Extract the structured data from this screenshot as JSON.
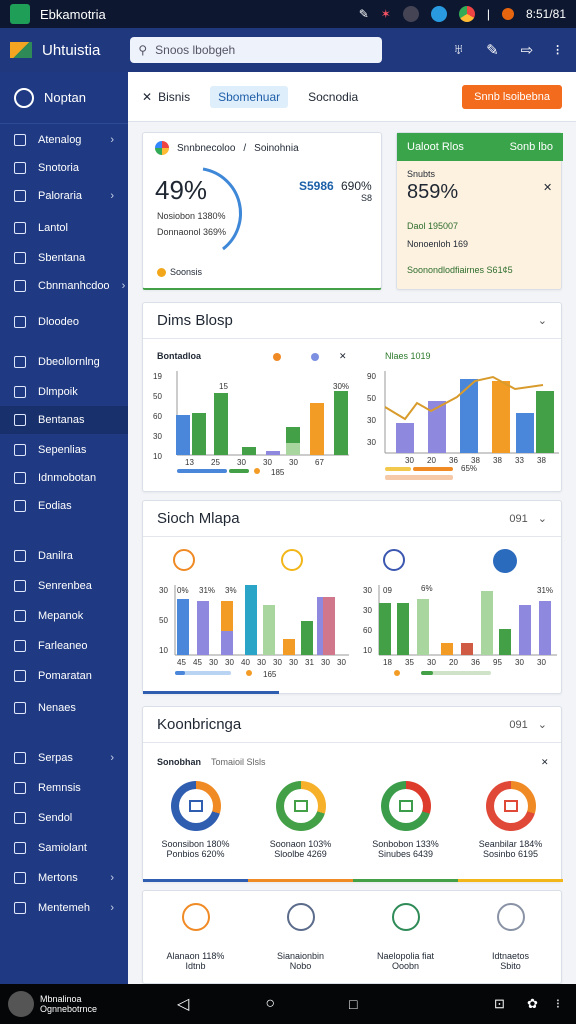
{
  "status_bar": {
    "app_name": "Ebkamotria",
    "time": "8:51/81"
  },
  "app_bar": {
    "title": "Uhtuistia",
    "search_placeholder": "Snoos lbobgeh"
  },
  "sidebar": {
    "header": "Noptan",
    "items": [
      {
        "label": "Atenalog",
        "chev": true
      },
      {
        "label": "Snotoria",
        "chev": false
      },
      {
        "label": "Paloraria",
        "chev": true
      },
      {
        "label": "Lantol",
        "chev": false
      },
      {
        "label": "Sbentana",
        "chev": false
      },
      {
        "label": "Cbnmanhcdoo",
        "chev": true
      },
      {
        "label": "Dloodeo",
        "chev": false
      },
      {
        "label": "Dbeollornlng",
        "chev": false
      },
      {
        "label": "Dlmpoik",
        "chev": false
      },
      {
        "label": "Bentanas",
        "chev": false
      },
      {
        "label": "Sepenlias",
        "chev": false
      },
      {
        "label": "Idnmobotan",
        "chev": false
      },
      {
        "label": "Eodias",
        "chev": false
      },
      {
        "label": "Danilra",
        "chev": false
      },
      {
        "label": "Senrenbea",
        "chev": false
      },
      {
        "label": "Mepanok",
        "chev": false
      },
      {
        "label": "Farleaneo",
        "chev": false
      },
      {
        "label": "Pomaratan",
        "chev": false
      },
      {
        "label": "Nenaes",
        "chev": false
      },
      {
        "label": "Serpas",
        "chev": true
      },
      {
        "label": "Remnsis",
        "chev": false
      },
      {
        "label": "Sendol",
        "chev": false
      },
      {
        "label": "Samiolant",
        "chev": false
      },
      {
        "label": "Mertons",
        "chev": true
      },
      {
        "label": "Mentemeh",
        "chev": true
      }
    ]
  },
  "toolbar": {
    "tab1": "Bisnis",
    "tab2": "Sbomehuar",
    "tab3": "Socnodia",
    "action": "Snnb lsoibebna"
  },
  "summary": {
    "breadcrumb1": "Snnbnecoloo",
    "breadcrumb2": "Soinohnia",
    "percent": "49%",
    "legend1": "Nosiobon 1380%",
    "legend2": "Donnaonol 369%",
    "stat_a": "S5986",
    "stat_b": "690%",
    "stat_b_sub": "S8",
    "footer": "Soonsis"
  },
  "promo": {
    "head_left": "Ualoot Rlos",
    "head_right": "Sonb lbo",
    "label": "Snubts",
    "value": "859%",
    "line1": "Daol 195007",
    "line2": "Nonoenloh 169",
    "footer": "Soonondlodfiairnes S61¢5"
  },
  "section1": {
    "title": "Dims Blosp",
    "left_chart": {
      "title": "Bontadloa",
      "y_ticks": [
        "19",
        "50",
        "60",
        "30",
        "10"
      ],
      "x_ticks": [
        "13",
        "25",
        "30",
        "30",
        "30",
        "67"
      ],
      "bar_labels": [
        "15",
        "30%"
      ],
      "legend": "185"
    },
    "right_chart": {
      "title": "Nlaes 1019",
      "y_ticks": [
        "90",
        "50",
        "30",
        "30"
      ],
      "x_ticks": [
        "30",
        "20",
        "36",
        "38",
        "38",
        "33",
        "38"
      ],
      "legend": "65%"
    }
  },
  "section2": {
    "title": "Sioch Mlapa",
    "badge": "091",
    "left_chart": {
      "y_ticks": [
        "30",
        "50",
        "10"
      ],
      "x_ticks": [
        "45",
        "45",
        "30",
        "30",
        "40",
        "30",
        "30",
        "30",
        "31",
        "30",
        "30"
      ],
      "bar_labels": [
        "0%",
        "31%",
        "3%"
      ],
      "legend": "165"
    },
    "right_chart": {
      "y_ticks": [
        "30",
        "30",
        "60",
        "10"
      ],
      "x_ticks": [
        "18",
        "35",
        "30",
        "20",
        "36",
        "95",
        "30",
        "30"
      ],
      "bar_labels": [
        "09",
        "6%",
        "31%"
      ]
    }
  },
  "section3": {
    "title": "Koonbricnga",
    "badge": "091",
    "sub_title": "Sonobhan",
    "sub_title2": "Tomaioil Slsls",
    "donuts": [
      {
        "l1": "Soonsibon 180%",
        "l2": "Ponbios 620%",
        "color": "#2f5db0",
        "accent": "#f08a24"
      },
      {
        "l1": "Soonaon 103%",
        "l2": "Sloolbe 4269",
        "color": "#43a047",
        "accent": "#f6b02a"
      },
      {
        "l1": "Sonbobon 133%",
        "l2": "Sinubes 6439",
        "color": "#3b9c4a",
        "accent": "#dd3b2b"
      },
      {
        "l1": "Seanbilar 184%",
        "l2": "Sosinbo 6195",
        "color": "#e04838",
        "accent": "#f08a24"
      }
    ],
    "tiles": [
      {
        "l1": "Alanaon 118%",
        "l2": "Idtnb"
      },
      {
        "l1": "Sianaionbin",
        "l2": "Nobo"
      },
      {
        "l1": "Naelopolia fiat",
        "l2": "Ooobn"
      },
      {
        "l1": "Idtnaetos",
        "l2": "Sbito"
      }
    ]
  },
  "nav_bar": {
    "user_line1": "Mbnalinoa",
    "user_line2": "Ognnebotrnce"
  },
  "colors": {
    "blue": "#4a86d9",
    "green": "#43a047",
    "orange": "#f39c25",
    "purple": "#8e88de",
    "lightgreen": "#a9d59e",
    "red": "#cf4d37"
  }
}
